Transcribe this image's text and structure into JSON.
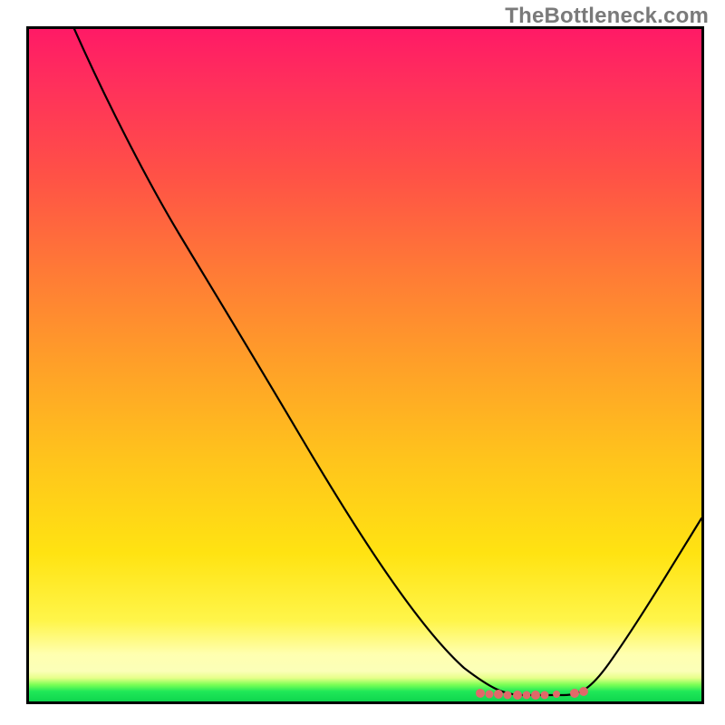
{
  "watermark": "TheBottleneck.com",
  "chart_data": {
    "type": "line",
    "title": "",
    "xlabel": "",
    "ylabel": "",
    "xlim": [
      0,
      100
    ],
    "ylim": [
      0,
      100
    ],
    "grid": false,
    "legend": false,
    "background": "vertical gradient red→orange→yellow→green (value 100→0)",
    "series": [
      {
        "name": "bottleneck-curve",
        "x": [
          7,
          12,
          18,
          22,
          30,
          40,
          50,
          60,
          65,
          70,
          73,
          76,
          80,
          84,
          88,
          95,
          100
        ],
        "values": [
          100,
          88,
          76,
          70,
          55,
          40,
          25,
          12,
          6,
          2,
          1,
          1,
          1,
          3,
          8,
          20,
          27
        ]
      }
    ],
    "annotations": [
      {
        "type": "scatter",
        "name": "valley-dots",
        "color": "#e06969",
        "x": [
          67,
          68.5,
          70,
          71.5,
          73,
          74,
          75.5,
          77,
          78.5,
          81,
          82.5
        ],
        "values": [
          1.2,
          1.0,
          1.0,
          0.9,
          0.9,
          0.9,
          0.9,
          0.9,
          1.0,
          1.1,
          1.3
        ]
      }
    ]
  }
}
